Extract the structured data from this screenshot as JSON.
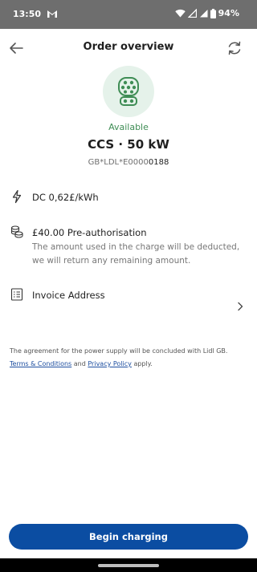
{
  "status_bar": {
    "time": "13:50",
    "battery": "94%",
    "icons": [
      "gmail-icon",
      "wifi-icon",
      "signal-icon",
      "signal-icon",
      "battery-icon"
    ]
  },
  "header": {
    "title": "Order overview",
    "back_icon": "arrow-left-icon",
    "refresh_icon": "refresh-icon"
  },
  "connector": {
    "icon": "ccs-connector-icon",
    "status": "Available",
    "title": "CCS · 50 kW",
    "id_prefix": "GB*LDL*E0000",
    "id_suffix": "0188"
  },
  "details": {
    "tariff": "DC  0,62£/kWh",
    "preauth_title": "£40.00 Pre-authorisation",
    "preauth_note": "The amount used in the charge will be deducted, we will return any remaining amount.",
    "invoice_label": "Invoice Address"
  },
  "legal": {
    "text_1": "The agreement for the power supply will be concluded with Lidl GB.",
    "terms_link": "Terms & Conditions",
    "and": " and ",
    "privacy_link": "Privacy Policy",
    "text_2": " apply."
  },
  "actions": {
    "begin_label": "Begin charging"
  },
  "colors": {
    "accent": "#0b4da2",
    "available": "#3f8d55",
    "connector_bg": "#e5f2ea"
  }
}
